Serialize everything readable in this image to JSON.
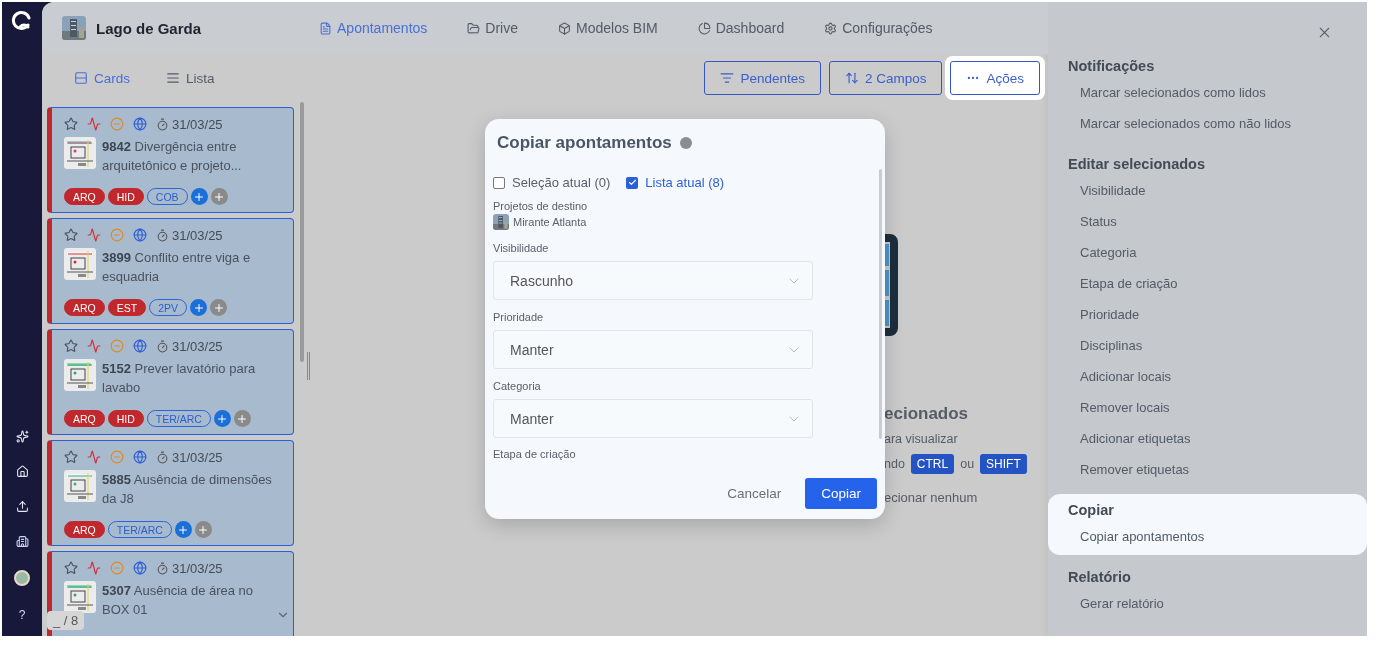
{
  "rail": {
    "help_label": "?"
  },
  "project": {
    "title": "Lago de Garda"
  },
  "nav": [
    {
      "label": "Apontamentos",
      "selected": true
    },
    {
      "label": "Drive",
      "selected": false
    },
    {
      "label": "Modelos BIM",
      "selected": false
    },
    {
      "label": "Dashboard",
      "selected": false
    },
    {
      "label": "Configurações",
      "selected": false
    }
  ],
  "views": [
    {
      "label": "Cards",
      "selected": true
    },
    {
      "label": "Lista",
      "selected": false
    }
  ],
  "toolbar": [
    {
      "label": "Pendentes",
      "highlighted": false
    },
    {
      "label": "2 Campos",
      "highlighted": false
    },
    {
      "label": "Ações",
      "highlighted": true
    }
  ],
  "cards": [
    {
      "date": "31/03/25",
      "number": "9842",
      "title": "Divergência entre arquitetônico e projeto...",
      "tags": [
        {
          "label": "ARQ",
          "kind": "discipline"
        },
        {
          "label": "HID",
          "kind": "discipline"
        },
        {
          "label": "COB",
          "kind": "location"
        }
      ]
    },
    {
      "date": "31/03/25",
      "number": "3899",
      "title": "Conflito entre viga e esquadria",
      "tags": [
        {
          "label": "ARQ",
          "kind": "discipline"
        },
        {
          "label": "EST",
          "kind": "discipline"
        },
        {
          "label": "2PV",
          "kind": "location"
        }
      ]
    },
    {
      "date": "31/03/25",
      "number": "5152",
      "title": "Prever lavatório para lavabo",
      "tags": [
        {
          "label": "ARQ",
          "kind": "discipline"
        },
        {
          "label": "HID",
          "kind": "discipline"
        },
        {
          "label": "TER/ARC",
          "kind": "location"
        }
      ]
    },
    {
      "date": "31/03/25",
      "number": "5885",
      "title": "Ausência de dimensões da J8",
      "tags": [
        {
          "label": "ARQ",
          "kind": "discipline"
        },
        {
          "label": "TER/ARC",
          "kind": "location"
        }
      ]
    },
    {
      "date": "31/03/25",
      "number": "5307",
      "title": "Ausência de área no BOX 01"
    }
  ],
  "pager": "_ / 8",
  "empty_state": {
    "heading": "ecionados",
    "line": "ara visualizar",
    "shortcut": {
      "before": "ndo",
      "keys": [
        "CTRL",
        "SHIFT"
      ],
      "joiner": "ou"
    },
    "last_line": "ecionar nenhum"
  },
  "modal": {
    "title": "Copiar apontamentos",
    "scope_options": [
      {
        "label": "Seleção atual (0)",
        "checked": false
      },
      {
        "label": "Lista atual (8)",
        "checked": true
      }
    ],
    "destination": {
      "label": "Projetos de destino",
      "project": "Mirante Atlanta"
    },
    "selects": [
      {
        "label": "Visibilidade",
        "value": "Rascunho"
      },
      {
        "label": "Prioridade",
        "value": "Manter"
      },
      {
        "label": "Categoria",
        "value": "Manter"
      }
    ],
    "next_label": "Etapa de criação",
    "buttons": [
      {
        "label": "Cancelar",
        "kind": "secondary"
      },
      {
        "label": "Copiar",
        "kind": "primary"
      }
    ]
  },
  "actions_panel": {
    "sections": [
      {
        "title": "Notificações",
        "highlighted": false,
        "items": [
          "Marcar selecionados como lidos",
          "Marcar selecionados como não lidos"
        ]
      },
      {
        "title": "Editar selecionados",
        "highlighted": false,
        "items": [
          "Visibilidade",
          "Status",
          "Categoria",
          "Etapa de criação",
          "Prioridade",
          "Disciplinas",
          "Adicionar locais",
          "Remover locais",
          "Adicionar etiquetas",
          "Remover etiquetas"
        ]
      },
      {
        "title": "Copiar",
        "highlighted": true,
        "items": [
          "Copiar apontamentos"
        ]
      },
      {
        "title": "Relatório",
        "highlighted": false,
        "items": [
          "Gerar relatório"
        ]
      }
    ]
  }
}
